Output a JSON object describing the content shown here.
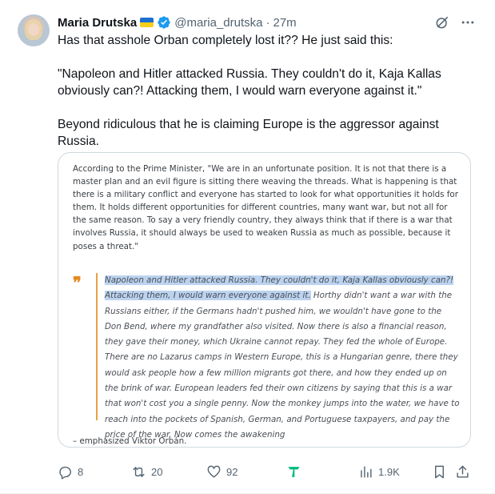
{
  "tweet": {
    "author": {
      "name": "Maria Drutska",
      "handle": "@maria_drutska",
      "time": "27m"
    },
    "text": {
      "p1": "Has that asshole Orban completely lost it?? He just said this:",
      "p2": "\"Napoleon and Hitler attacked Russia. They couldn't do it, Kaja Kallas obviously can?! Attacking them, I would warn everyone against it.\"",
      "p3": "Beyond ridiculous that he is claiming Europe is the aggressor against Russia."
    },
    "card": {
      "intro": "According to the Prime Minister, \"We are in an unfortunate position. It is not that there is a master plan and an evil figure is sitting there weaving the threads. What is happening is that there is a military conflict and everyone has started to look for what opportunities it holds for them. It holds different opportunities for different countries, many want war, but not all for the same reason. To say a very friendly country, they always think that if there is a war that involves Russia, it should always be used to weaken Russia as much as possible, because it poses a threat.\"",
      "quote_mark": "❞",
      "quote_highlight": "Napoleon and Hitler attacked Russia. They couldn't do it, Kaja Kallas obviously can?! Attacking them, I would warn everyone against it.",
      "quote_rest": " Horthy didn't want a war with the Russians either, if the Germans hadn't pushed him, we wouldn't have gone to the Don Bend, where my grandfather also visited. Now there is also a financial reason, they gave their money, which Ukraine cannot repay. They fed the whole of Europe. There are no Lazarus camps in Western Europe, this is a Hungarian genre, there they would ask people how a few million migrants got there, and how they ended up on the brink of war. European leaders fed their own citizens by saying that this is a war that won't cost you a single penny. Now the monkey jumps into the water, we have to reach into the pockets of Spanish, German, and Portuguese taxpayers, and pay the price of the war. Now comes the awakening",
      "attribution": "– emphasized Viktor Orbán."
    },
    "actions": {
      "replies": "8",
      "reposts": "20",
      "likes": "92",
      "views": "1.9K"
    }
  },
  "colors": {
    "verified": "#1d9bf0",
    "grok": "#00ba7c",
    "muted": "#536471",
    "quote_accent": "#e48a22"
  }
}
